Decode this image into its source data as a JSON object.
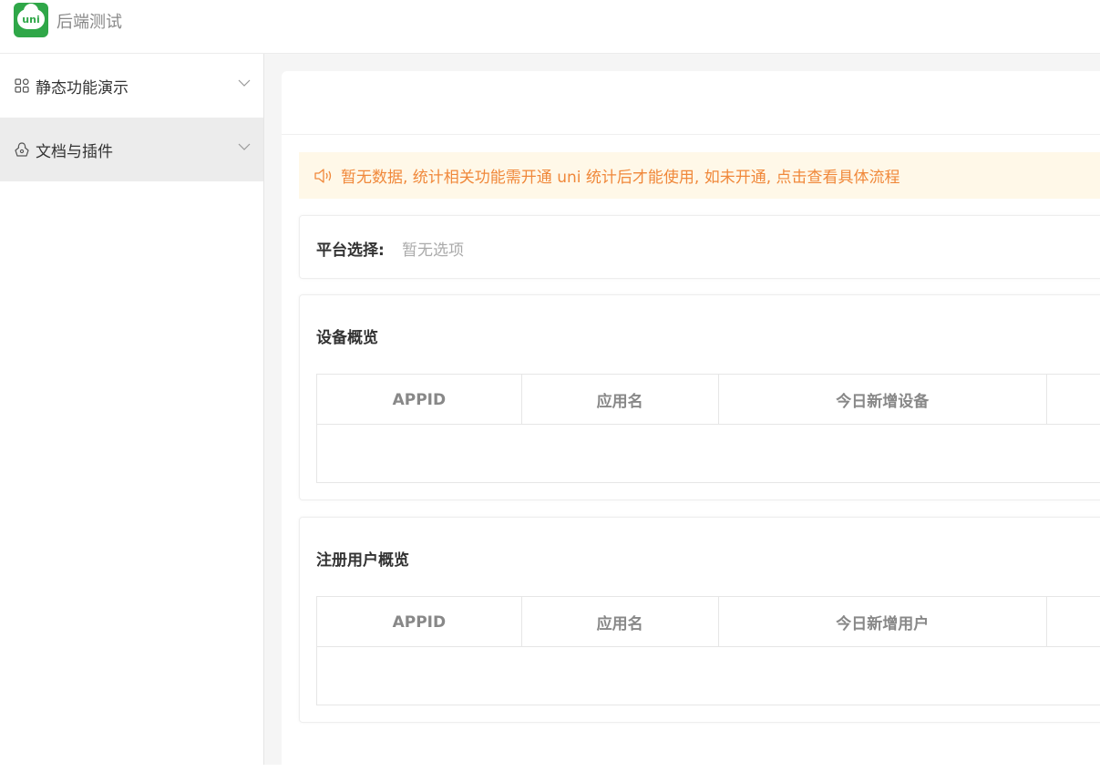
{
  "header": {
    "logo_text": "uni",
    "app_title": "后端测试"
  },
  "sidebar": {
    "items": [
      {
        "label": "静态功能演示",
        "icon": "grid-icon",
        "active": false
      },
      {
        "label": "文档与插件",
        "icon": "plugin-icon",
        "active": true
      }
    ]
  },
  "notice": {
    "text": "暂无数据, 统计相关功能需开通 uni 统计后才能使用, 如未开通, 点击查看具体流程",
    "icon": "speaker-icon",
    "color": "#f0883a"
  },
  "platform_filter": {
    "label": "平台选择:",
    "value": "暂无选项"
  },
  "device_overview": {
    "title": "设备概览",
    "columns": [
      "APPID",
      "应用名",
      "今日新增设备"
    ]
  },
  "user_overview": {
    "title": "注册用户概览",
    "columns": [
      "APPID",
      "应用名",
      "今日新增用户"
    ]
  },
  "colors": {
    "brand": "#2fa748",
    "notice_bg": "#fff8e8",
    "sidebar_active": "#ececec"
  }
}
